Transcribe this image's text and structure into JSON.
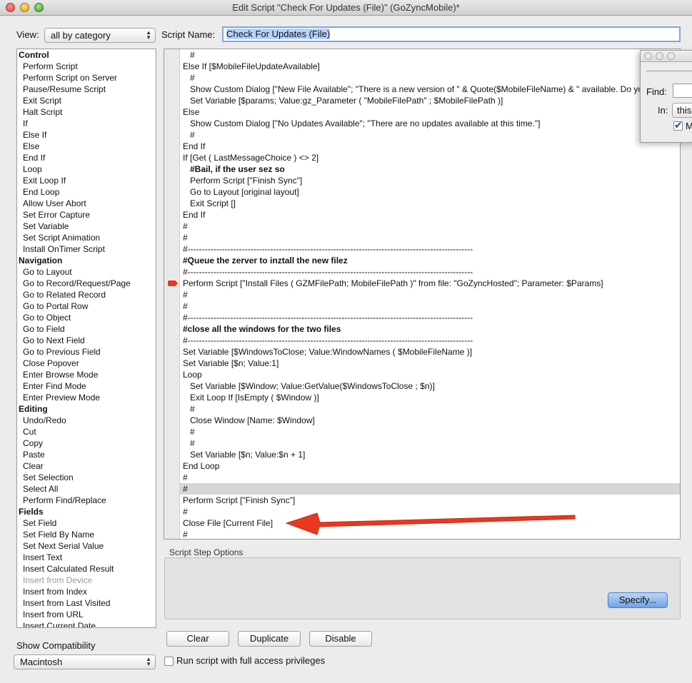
{
  "window": {
    "title": "Edit Script \"Check For Updates (File)\" (GoZyncMobile)*"
  },
  "view": {
    "label": "View:",
    "selected": "all by category"
  },
  "script_name": {
    "label": "Script Name:",
    "value": "Check For Updates (File)"
  },
  "step_list": [
    {
      "label": "Control",
      "kind": "cat"
    },
    {
      "label": "Perform Script",
      "kind": "item"
    },
    {
      "label": "Perform Script on Server",
      "kind": "item"
    },
    {
      "label": "Pause/Resume Script",
      "kind": "item"
    },
    {
      "label": "Exit Script",
      "kind": "item"
    },
    {
      "label": "Halt Script",
      "kind": "item"
    },
    {
      "label": "If",
      "kind": "item"
    },
    {
      "label": "Else If",
      "kind": "item"
    },
    {
      "label": "Else",
      "kind": "item"
    },
    {
      "label": "End If",
      "kind": "item"
    },
    {
      "label": "Loop",
      "kind": "item"
    },
    {
      "label": "Exit Loop If",
      "kind": "item"
    },
    {
      "label": "End Loop",
      "kind": "item"
    },
    {
      "label": "Allow User Abort",
      "kind": "item"
    },
    {
      "label": "Set Error Capture",
      "kind": "item"
    },
    {
      "label": "Set Variable",
      "kind": "item"
    },
    {
      "label": "Set Script Animation",
      "kind": "item"
    },
    {
      "label": "Install OnTimer Script",
      "kind": "item"
    },
    {
      "label": "Navigation",
      "kind": "cat"
    },
    {
      "label": "Go to Layout",
      "kind": "item"
    },
    {
      "label": "Go to Record/Request/Page",
      "kind": "item"
    },
    {
      "label": "Go to Related Record",
      "kind": "item"
    },
    {
      "label": "Go to Portal Row",
      "kind": "item"
    },
    {
      "label": "Go to Object",
      "kind": "item"
    },
    {
      "label": "Go to Field",
      "kind": "item"
    },
    {
      "label": "Go to Next Field",
      "kind": "item"
    },
    {
      "label": "Go to Previous Field",
      "kind": "item"
    },
    {
      "label": "Close Popover",
      "kind": "item"
    },
    {
      "label": "Enter Browse Mode",
      "kind": "item"
    },
    {
      "label": "Enter Find Mode",
      "kind": "item"
    },
    {
      "label": "Enter Preview Mode",
      "kind": "item"
    },
    {
      "label": "Editing",
      "kind": "cat"
    },
    {
      "label": "Undo/Redo",
      "kind": "item"
    },
    {
      "label": "Cut",
      "kind": "item"
    },
    {
      "label": "Copy",
      "kind": "item"
    },
    {
      "label": "Paste",
      "kind": "item"
    },
    {
      "label": "Clear",
      "kind": "item"
    },
    {
      "label": "Set Selection",
      "kind": "item"
    },
    {
      "label": "Select All",
      "kind": "item"
    },
    {
      "label": "Perform Find/Replace",
      "kind": "item"
    },
    {
      "label": "Fields",
      "kind": "cat"
    },
    {
      "label": "Set Field",
      "kind": "item"
    },
    {
      "label": "Set Field By Name",
      "kind": "item"
    },
    {
      "label": "Set Next Serial Value",
      "kind": "item"
    },
    {
      "label": "Insert Text",
      "kind": "item"
    },
    {
      "label": "Insert Calculated Result",
      "kind": "item"
    },
    {
      "label": "Insert from Device",
      "kind": "dim"
    },
    {
      "label": "Insert from Index",
      "kind": "item"
    },
    {
      "label": "Insert from Last Visited",
      "kind": "item"
    },
    {
      "label": "Insert from URL",
      "kind": "item"
    },
    {
      "label": "Insert Current Date",
      "kind": "item"
    }
  ],
  "script_lines": [
    {
      "text": "#",
      "indent": 1
    },
    {
      "text": "Else If [$MobileFileUpdateAvailable]",
      "indent": 0
    },
    {
      "text": "#",
      "indent": 1
    },
    {
      "text": "Show Custom Dialog [\"New File Available\"; \"There is a new version of \" & Quote($MobileFileName) & \" available. Do you",
      "indent": 1
    },
    {
      "text": "Set Variable [$params; Value:gz_Parameter ( \"MobileFilePath\" ; $MobileFilePath )]",
      "indent": 1
    },
    {
      "text": "Else",
      "indent": 0
    },
    {
      "text": "Show Custom Dialog [\"No Updates Available\"; \"There are no updates available at this time.\"]",
      "indent": 1
    },
    {
      "text": "#",
      "indent": 1
    },
    {
      "text": "End If",
      "indent": 0
    },
    {
      "text": "If [Get ( LastMessageChoice ) <> 2]",
      "indent": 0
    },
    {
      "text": "#Bail, if the user sez so",
      "indent": 1,
      "bold": true
    },
    {
      "text": "Perform Script [\"Finish Sync\"]",
      "indent": 1
    },
    {
      "text": "Go to Layout [original layout]",
      "indent": 1
    },
    {
      "text": "Exit Script []",
      "indent": 1
    },
    {
      "text": "End If",
      "indent": 0
    },
    {
      "text": "#",
      "indent": 0
    },
    {
      "text": "#",
      "indent": 0
    },
    {
      "text": "#----------------------------------------------------------------------------------------------------",
      "indent": 0
    },
    {
      "text": "#Queue the zerver to inztall the new filez",
      "indent": 0,
      "bold": true
    },
    {
      "text": "#----------------------------------------------------------------------------------------------------",
      "indent": 0
    },
    {
      "text": "Perform Script [\"Install Files ( GZMFilePath; MobileFilePath  )\" from file: \"GoZyncHosted\"; Parameter: $Params]",
      "indent": 0,
      "breakpoint": true
    },
    {
      "text": "#",
      "indent": 0
    },
    {
      "text": "#",
      "indent": 0
    },
    {
      "text": "#----------------------------------------------------------------------------------------------------",
      "indent": 0
    },
    {
      "text": "#close all the windows for the two files",
      "indent": 0,
      "bold": true
    },
    {
      "text": "#----------------------------------------------------------------------------------------------------",
      "indent": 0
    },
    {
      "text": "Set Variable [$WindowsToClose; Value:WindowNames (  $MobileFileName  )]",
      "indent": 0
    },
    {
      "text": "Set Variable [$n; Value:1]",
      "indent": 0
    },
    {
      "text": "Loop",
      "indent": 0
    },
    {
      "text": "Set Variable [$Window; Value:GetValue($WindowsToClose ; $n)]",
      "indent": 1
    },
    {
      "text": "Exit Loop If [IsEmpty ( $Window )]",
      "indent": 1
    },
    {
      "text": "#",
      "indent": 1
    },
    {
      "text": "Close Window [Name: $Window]",
      "indent": 1
    },
    {
      "text": "#",
      "indent": 1
    },
    {
      "text": "#",
      "indent": 1
    },
    {
      "text": "Set Variable [$n; Value:$n + 1]",
      "indent": 1
    },
    {
      "text": "End Loop",
      "indent": 0
    },
    {
      "text": "#",
      "indent": 0
    },
    {
      "text": "#",
      "indent": 0,
      "selected": true
    },
    {
      "text": "Perform Script [\"Finish Sync\"]",
      "indent": 0
    },
    {
      "text": "#",
      "indent": 0
    },
    {
      "text": "Close File [Current File]",
      "indent": 0
    },
    {
      "text": "#",
      "indent": 0
    }
  ],
  "find_panel": {
    "find_label": "Find:",
    "in_label": "In:",
    "in_value": "this",
    "check_label": "M"
  },
  "options": {
    "label": "Script Step Options",
    "specify": "Specify..."
  },
  "buttons": {
    "clear": "Clear",
    "duplicate": "Duplicate",
    "disable": "Disable"
  },
  "compat": {
    "label": "Show Compatibility",
    "selected": "Macintosh"
  },
  "privileges": {
    "label": "Run script with full access privileges"
  },
  "colors": {
    "arrow": "#e8381f",
    "selection": "#b5d3ff",
    "button_blue": "#6fa3e8"
  }
}
